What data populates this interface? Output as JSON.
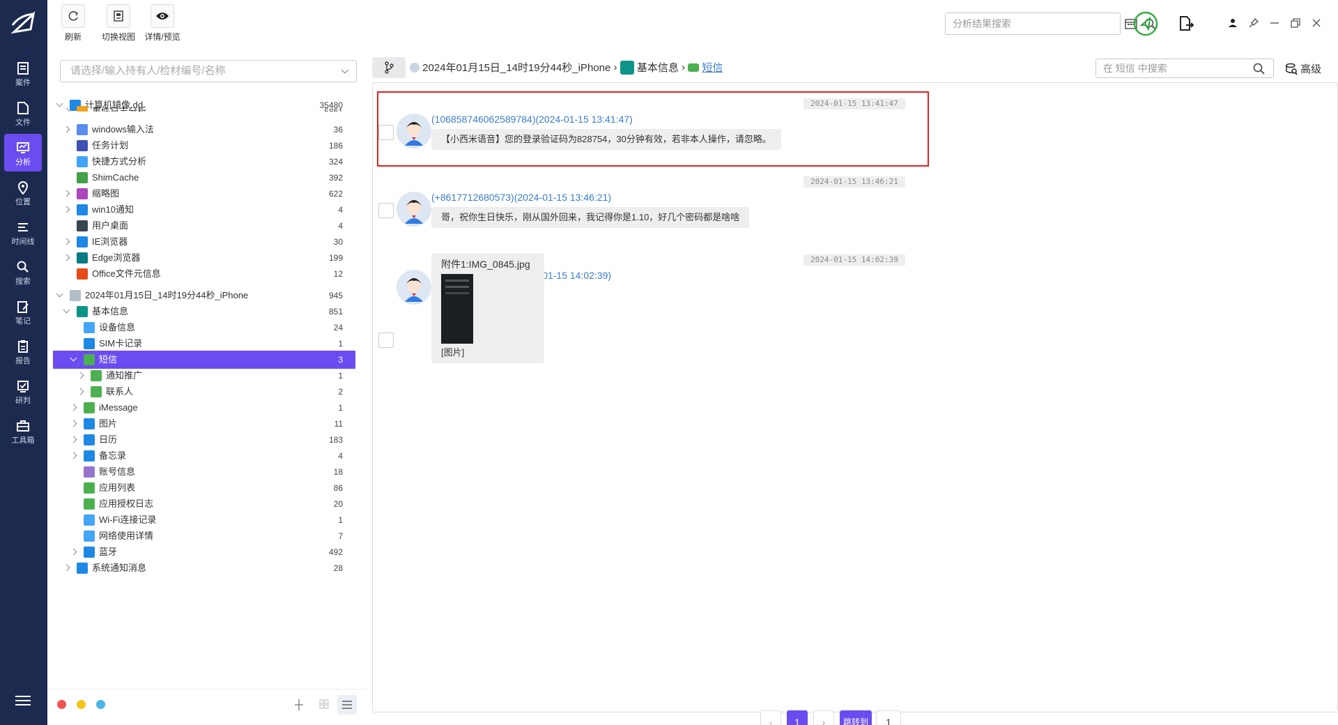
{
  "app": {
    "accent": "#6c4cf0",
    "nav_bg": "#1d2a4f"
  },
  "nav": {
    "items": [
      {
        "label": "案件",
        "icon": "case-icon"
      },
      {
        "label": "文件",
        "icon": "file-icon"
      },
      {
        "label": "分析",
        "icon": "analysis-icon"
      },
      {
        "label": "位置",
        "icon": "location-icon"
      },
      {
        "label": "时间线",
        "icon": "timeline-icon"
      },
      {
        "label": "搜索",
        "icon": "search-icon"
      },
      {
        "label": "笔记",
        "icon": "note-icon"
      },
      {
        "label": "报告",
        "icon": "report-icon"
      },
      {
        "label": "研判",
        "icon": "judge-icon"
      },
      {
        "label": "工具箱",
        "icon": "toolbox-icon"
      }
    ],
    "active": "分析"
  },
  "toolbar": {
    "refresh_label": "刷新",
    "switch_view_label": "切换视图",
    "detail_label": "详情/预览",
    "search_placeholder": "分析结果搜索"
  },
  "left": {
    "owner_placeholder": "请选择/输入持有人/检材编号/名称",
    "tree": [
      {
        "label": "计算机镜像.dd",
        "count": "35480",
        "level": 0,
        "arrow": "down",
        "icon": "windows-icon",
        "color": "#1e88e5"
      },
      {
        "label": "事件日志分析",
        "count": "5861",
        "level": 1,
        "arrow": "right",
        "icon": "event-log-icon",
        "color": "#f0a020",
        "clipped": true
      },
      {
        "label": "windows输入法",
        "count": "36",
        "level": 1,
        "arrow": "right",
        "icon": "keyboard-icon",
        "color": "#5b8def"
      },
      {
        "label": "任务计划",
        "count": "186",
        "level": 1,
        "arrow": "",
        "icon": "task-icon",
        "color": "#3f51b5"
      },
      {
        "label": "快捷方式分析",
        "count": "324",
        "level": 1,
        "arrow": "",
        "icon": "shortcut-icon",
        "color": "#42a5f5"
      },
      {
        "label": "ShimCache",
        "count": "392",
        "level": 1,
        "arrow": "",
        "icon": "cache-icon",
        "color": "#43a047"
      },
      {
        "label": "缩略图",
        "count": "622",
        "level": 1,
        "arrow": "right",
        "icon": "thumbnail-icon",
        "color": "#ab47bc"
      },
      {
        "label": "win10通知",
        "count": "4",
        "level": 1,
        "arrow": "right",
        "icon": "bell-icon",
        "color": "#1e88e5"
      },
      {
        "label": "用户桌面",
        "count": "4",
        "level": 1,
        "arrow": "",
        "icon": "desktop-icon",
        "color": "#37474f"
      },
      {
        "label": "IE浏览器",
        "count": "30",
        "level": 1,
        "arrow": "right",
        "icon": "ie-icon",
        "color": "#1e88e5"
      },
      {
        "label": "Edge浏览器",
        "count": "199",
        "level": 1,
        "arrow": "right",
        "icon": "edge-icon",
        "color": "#0a7b83"
      },
      {
        "label": "Office文件元信息",
        "count": "12",
        "level": 1,
        "arrow": "",
        "icon": "office-icon",
        "color": "#e64a19"
      },
      {
        "label": "2024年01月15日_14时19分44秒_iPhone",
        "count": "945",
        "level": 0,
        "arrow": "down",
        "icon": "apple-icon",
        "color": "#b0bec5",
        "gap": true
      },
      {
        "label": "基本信息",
        "count": "851",
        "level": 1,
        "arrow": "down",
        "icon": "info-icon",
        "color": "#0d9488"
      },
      {
        "label": "设备信息",
        "count": "24",
        "level": 2,
        "arrow": "",
        "icon": "device-icon",
        "color": "#42a5f5"
      },
      {
        "label": "SIM卡记录",
        "count": "1",
        "level": 2,
        "arrow": "",
        "icon": "sim-icon",
        "color": "#1e88e5"
      },
      {
        "label": "短信",
        "count": "3",
        "level": 2,
        "arrow": "down",
        "icon": "sms-icon",
        "color": "#4caf50",
        "selected": true
      },
      {
        "label": "通知推广",
        "count": "1",
        "level": 3,
        "arrow": "right",
        "icon": "sms-icon",
        "color": "#4caf50"
      },
      {
        "label": "联系人",
        "count": "2",
        "level": 3,
        "arrow": "right",
        "icon": "sms-icon",
        "color": "#4caf50"
      },
      {
        "label": "iMessage",
        "count": "1",
        "level": 2,
        "arrow": "right",
        "icon": "imessage-icon",
        "color": "#4caf50"
      },
      {
        "label": "图片",
        "count": "11",
        "level": 2,
        "arrow": "right",
        "icon": "image-icon",
        "color": "#1e88e5"
      },
      {
        "label": "日历",
        "count": "183",
        "level": 2,
        "arrow": "right",
        "icon": "calendar-icon",
        "color": "#1e88e5"
      },
      {
        "label": "备忘录",
        "count": "4",
        "level": 2,
        "arrow": "right",
        "icon": "memo-icon",
        "color": "#1e88e5"
      },
      {
        "label": "账号信息",
        "count": "18",
        "level": 2,
        "arrow": "",
        "icon": "account-icon",
        "color": "#9575cd"
      },
      {
        "label": "应用列表",
        "count": "86",
        "level": 2,
        "arrow": "",
        "icon": "app-list-icon",
        "color": "#4caf50"
      },
      {
        "label": "应用授权日志",
        "count": "20",
        "level": 2,
        "arrow": "",
        "icon": "app-auth-icon",
        "color": "#4caf50"
      },
      {
        "label": "Wi-Fi连接记录",
        "count": "1",
        "level": 2,
        "arrow": "",
        "icon": "wifi-icon",
        "color": "#42a5f5"
      },
      {
        "label": "网络使用详情",
        "count": "7",
        "level": 2,
        "arrow": "",
        "icon": "network-icon",
        "color": "#42a5f5"
      },
      {
        "label": "蓝牙",
        "count": "492",
        "level": 2,
        "arrow": "right",
        "icon": "bluetooth-icon",
        "color": "#1e88e5"
      },
      {
        "label": "系统通知消息",
        "count": "28",
        "level": 1,
        "arrow": "right",
        "icon": "notify-icon",
        "color": "#1e88e5"
      }
    ]
  },
  "breadcrumb": {
    "device": "2024年01月15日_14时19分44秒_iPhone",
    "category": "基本信息",
    "current": "短信",
    "search_placeholder": "在 短信 中搜索",
    "advanced_label": "高级"
  },
  "messages": [
    {
      "time": "2024-01-15 13:41:47",
      "sender": "(10685874606258978​4)(2024-01-15 13:41:47)",
      "text": "【小西米语音】您的登录验证码为828754，30分钟有效，若非本人操作，请忽略。"
    },
    {
      "time": "2024-01-15 13:46:21",
      "sender": "(+8617712680573)(2024-01-15 13:46:21)",
      "text": "哥，祝你生日快乐，刚从国外回来，我记得你是1.10，好几个密码都是啥啥"
    },
    {
      "time": "2024-01-15 14:02:39",
      "sender": "(+8615599005006)(2024-01-15 14:02:39)",
      "attachment_name": "附件1:IMG_0845.jpg",
      "attachment_caption": "[图片]"
    }
  ],
  "pager": {
    "current": "1",
    "jump_label": "跳转到",
    "jump_value": "1"
  }
}
